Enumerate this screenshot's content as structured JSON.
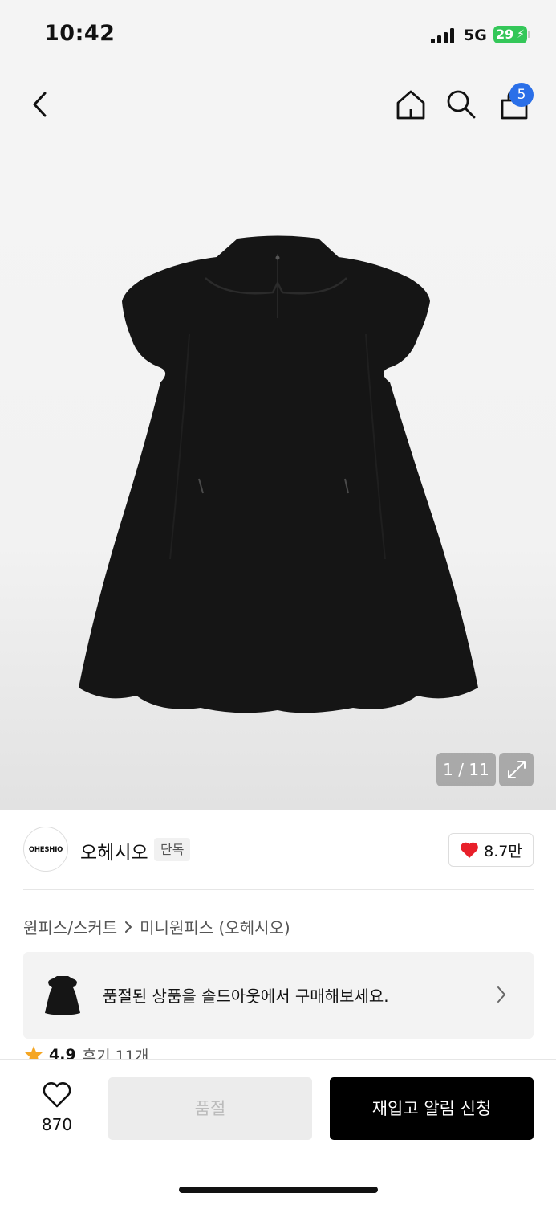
{
  "status_bar": {
    "time": "10:42",
    "network": "5G",
    "battery": "29"
  },
  "nav": {
    "back_icon": "chevron-left-icon",
    "home_icon": "home-icon",
    "search_icon": "search-icon",
    "cart_icon": "shopping-bag-icon",
    "cart_badge": "5"
  },
  "gallery": {
    "current": "1",
    "total": "11",
    "indicator": "1 / 11",
    "expand_icon": "expand-icon"
  },
  "brand": {
    "logo_text": "OHESHIO",
    "name": "오헤시오",
    "tag": "단독",
    "likes": "8.7만"
  },
  "breadcrumb": {
    "category": "원피스/스커트",
    "subcategory": "미니원피스 (오헤시오)"
  },
  "soldout_banner": {
    "text": "품절된 상품을 솔드아웃에서 구매해보세요."
  },
  "rating": {
    "score": "4.9",
    "reviews": "후기 11개"
  },
  "bottom_bar": {
    "wish_count": "870",
    "soldout_label": "품절",
    "restock_label": "재입고 알림 신청"
  },
  "colors": {
    "accent_blue": "#2a6fe8",
    "heart_red": "#e8202a",
    "star_orange": "#f5a623",
    "battery_green": "#34c759"
  }
}
